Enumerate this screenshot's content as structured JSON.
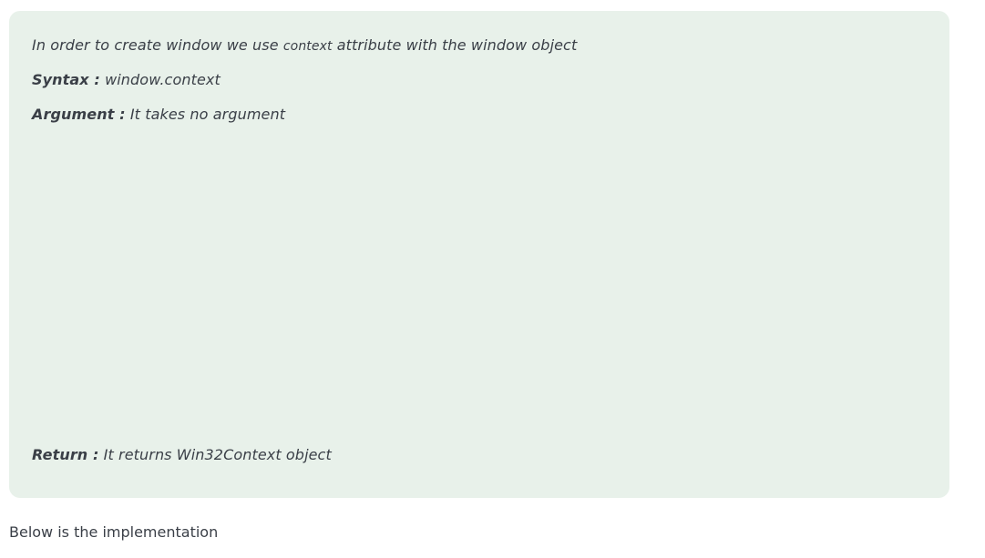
{
  "box": {
    "intro_before": "In order to create window we use ",
    "intro_code": "context",
    "intro_after": " attribute with the window object",
    "syntax_label": "Syntax :",
    "syntax_value": " window.context",
    "argument_label": "Argument :",
    "argument_value": " It takes no argument",
    "return_label": "Return :",
    "return_value": " It returns Win32Context object"
  },
  "below_text": "Below is the implementation",
  "colors": {
    "box_background": "#e8f1ea",
    "text": "#3a3f47"
  }
}
